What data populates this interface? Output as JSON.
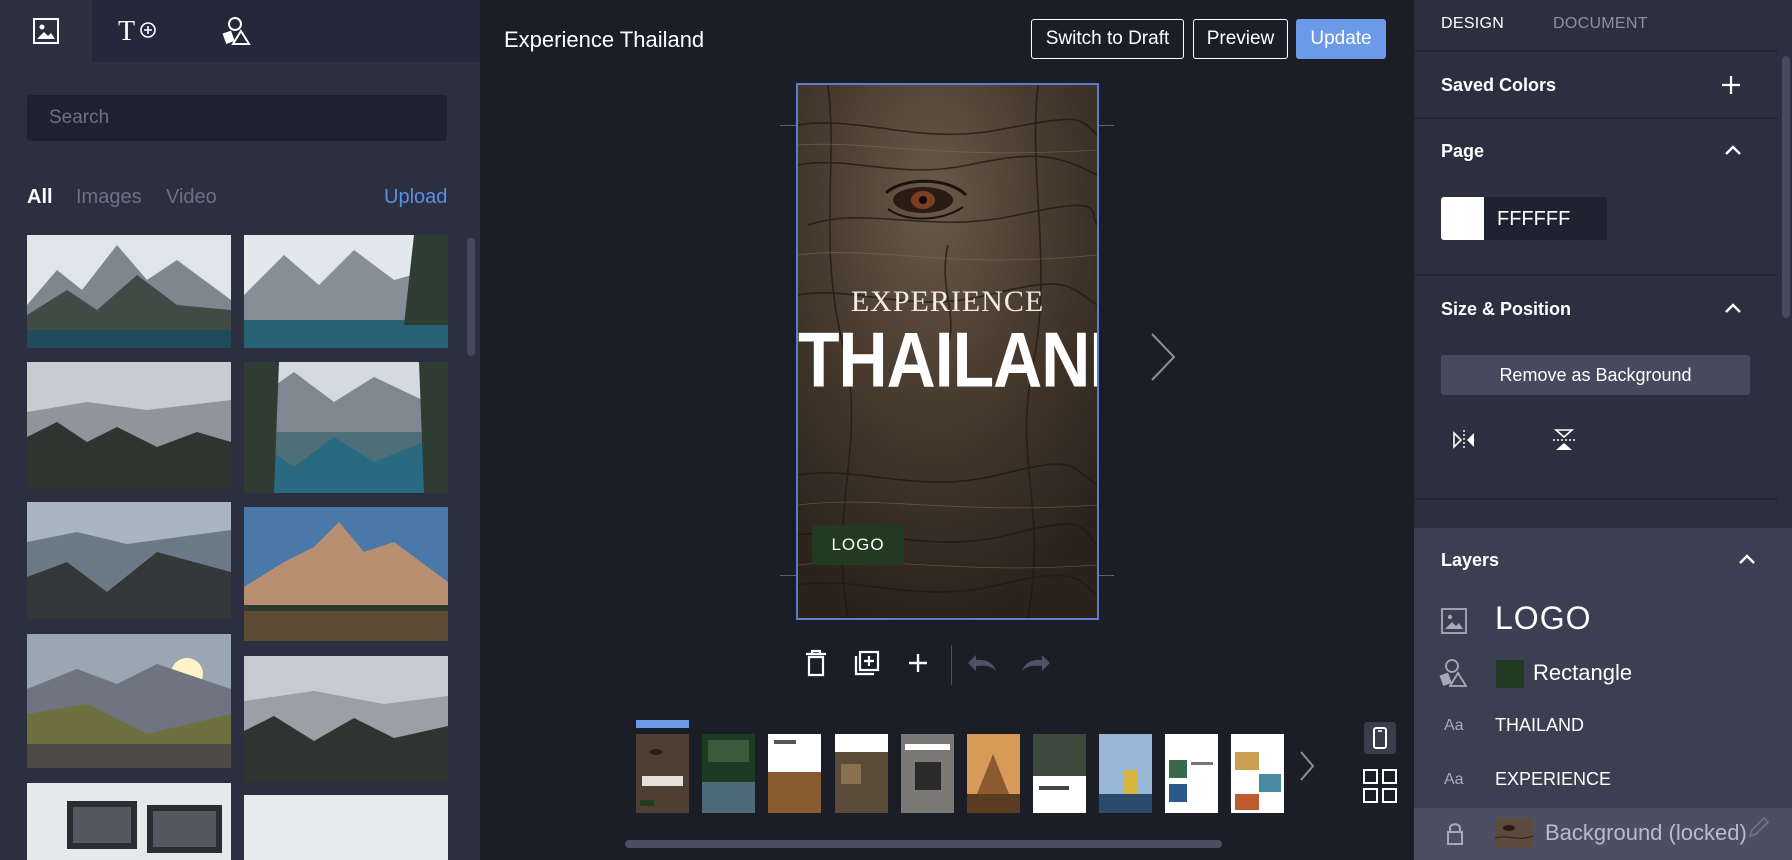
{
  "left_panel": {
    "tabs": [
      {
        "name": "images",
        "icon": "image-icon"
      },
      {
        "name": "text",
        "icon": "add-text-icon"
      },
      {
        "name": "elements",
        "icon": "shapes-icon"
      }
    ],
    "search_placeholder": "Search",
    "filters": {
      "all": "All",
      "images": "Images",
      "video": "Video",
      "upload": "Upload"
    }
  },
  "editor": {
    "document_title": "Experience Thailand",
    "buttons": {
      "switch_to_draft": "Switch to Draft",
      "preview": "Preview",
      "update": "Update"
    },
    "canvas": {
      "experience": "EXPERIENCE",
      "thailand": "THAILAND",
      "logo": "LOGO"
    }
  },
  "right_panel": {
    "tabs": {
      "design": "DESIGN",
      "document": "DOCUMENT"
    },
    "saved_colors": "Saved Colors",
    "page": {
      "title": "Page",
      "color_value": "FFFFFF"
    },
    "size_position": {
      "title": "Size & Position",
      "remove_background": "Remove as Background"
    },
    "layers": {
      "title": "Layers",
      "items": [
        {
          "label": "LOGO",
          "type": "image"
        },
        {
          "label": "Rectangle",
          "type": "shape"
        },
        {
          "label": "THAILAND",
          "type": "text",
          "prefix": "Aa"
        },
        {
          "label": "EXPERIENCE",
          "type": "text",
          "prefix": "Aa"
        },
        {
          "label": "Background (locked)",
          "type": "background"
        }
      ]
    }
  },
  "colors": {
    "accent": "#6a9ae8",
    "panel": "#2c2f3f",
    "workspace": "#1b1d27",
    "layers_panel": "#3b3f51",
    "logo_box": "#233a22"
  }
}
